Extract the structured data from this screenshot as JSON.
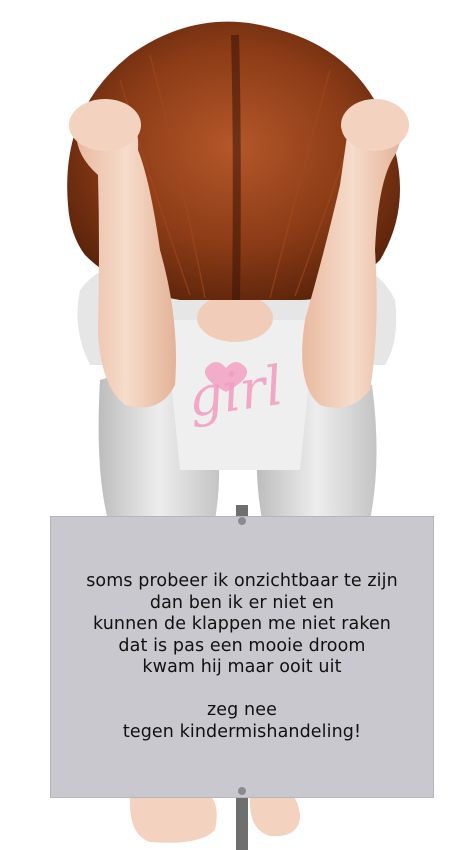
{
  "shirt": {
    "print": "girl"
  },
  "sign": {
    "poem": [
      "soms probeer ik onzichtbaar te zijn",
      "dan ben ik er niet en",
      "kunnen de klappen me niet raken",
      "dat is pas een mooie droom",
      "kwam hij maar ooit uit"
    ],
    "slogan": [
      "zeg nee",
      "tegen kindermishandeling!"
    ],
    "colors": {
      "panel": "#c8c8ce",
      "text": "#111111"
    }
  },
  "colors": {
    "hair": "#8a3b16",
    "skin": "#f3d2bf",
    "clothes": "#e4e4e4",
    "shirt_print": "#f19cc0"
  }
}
